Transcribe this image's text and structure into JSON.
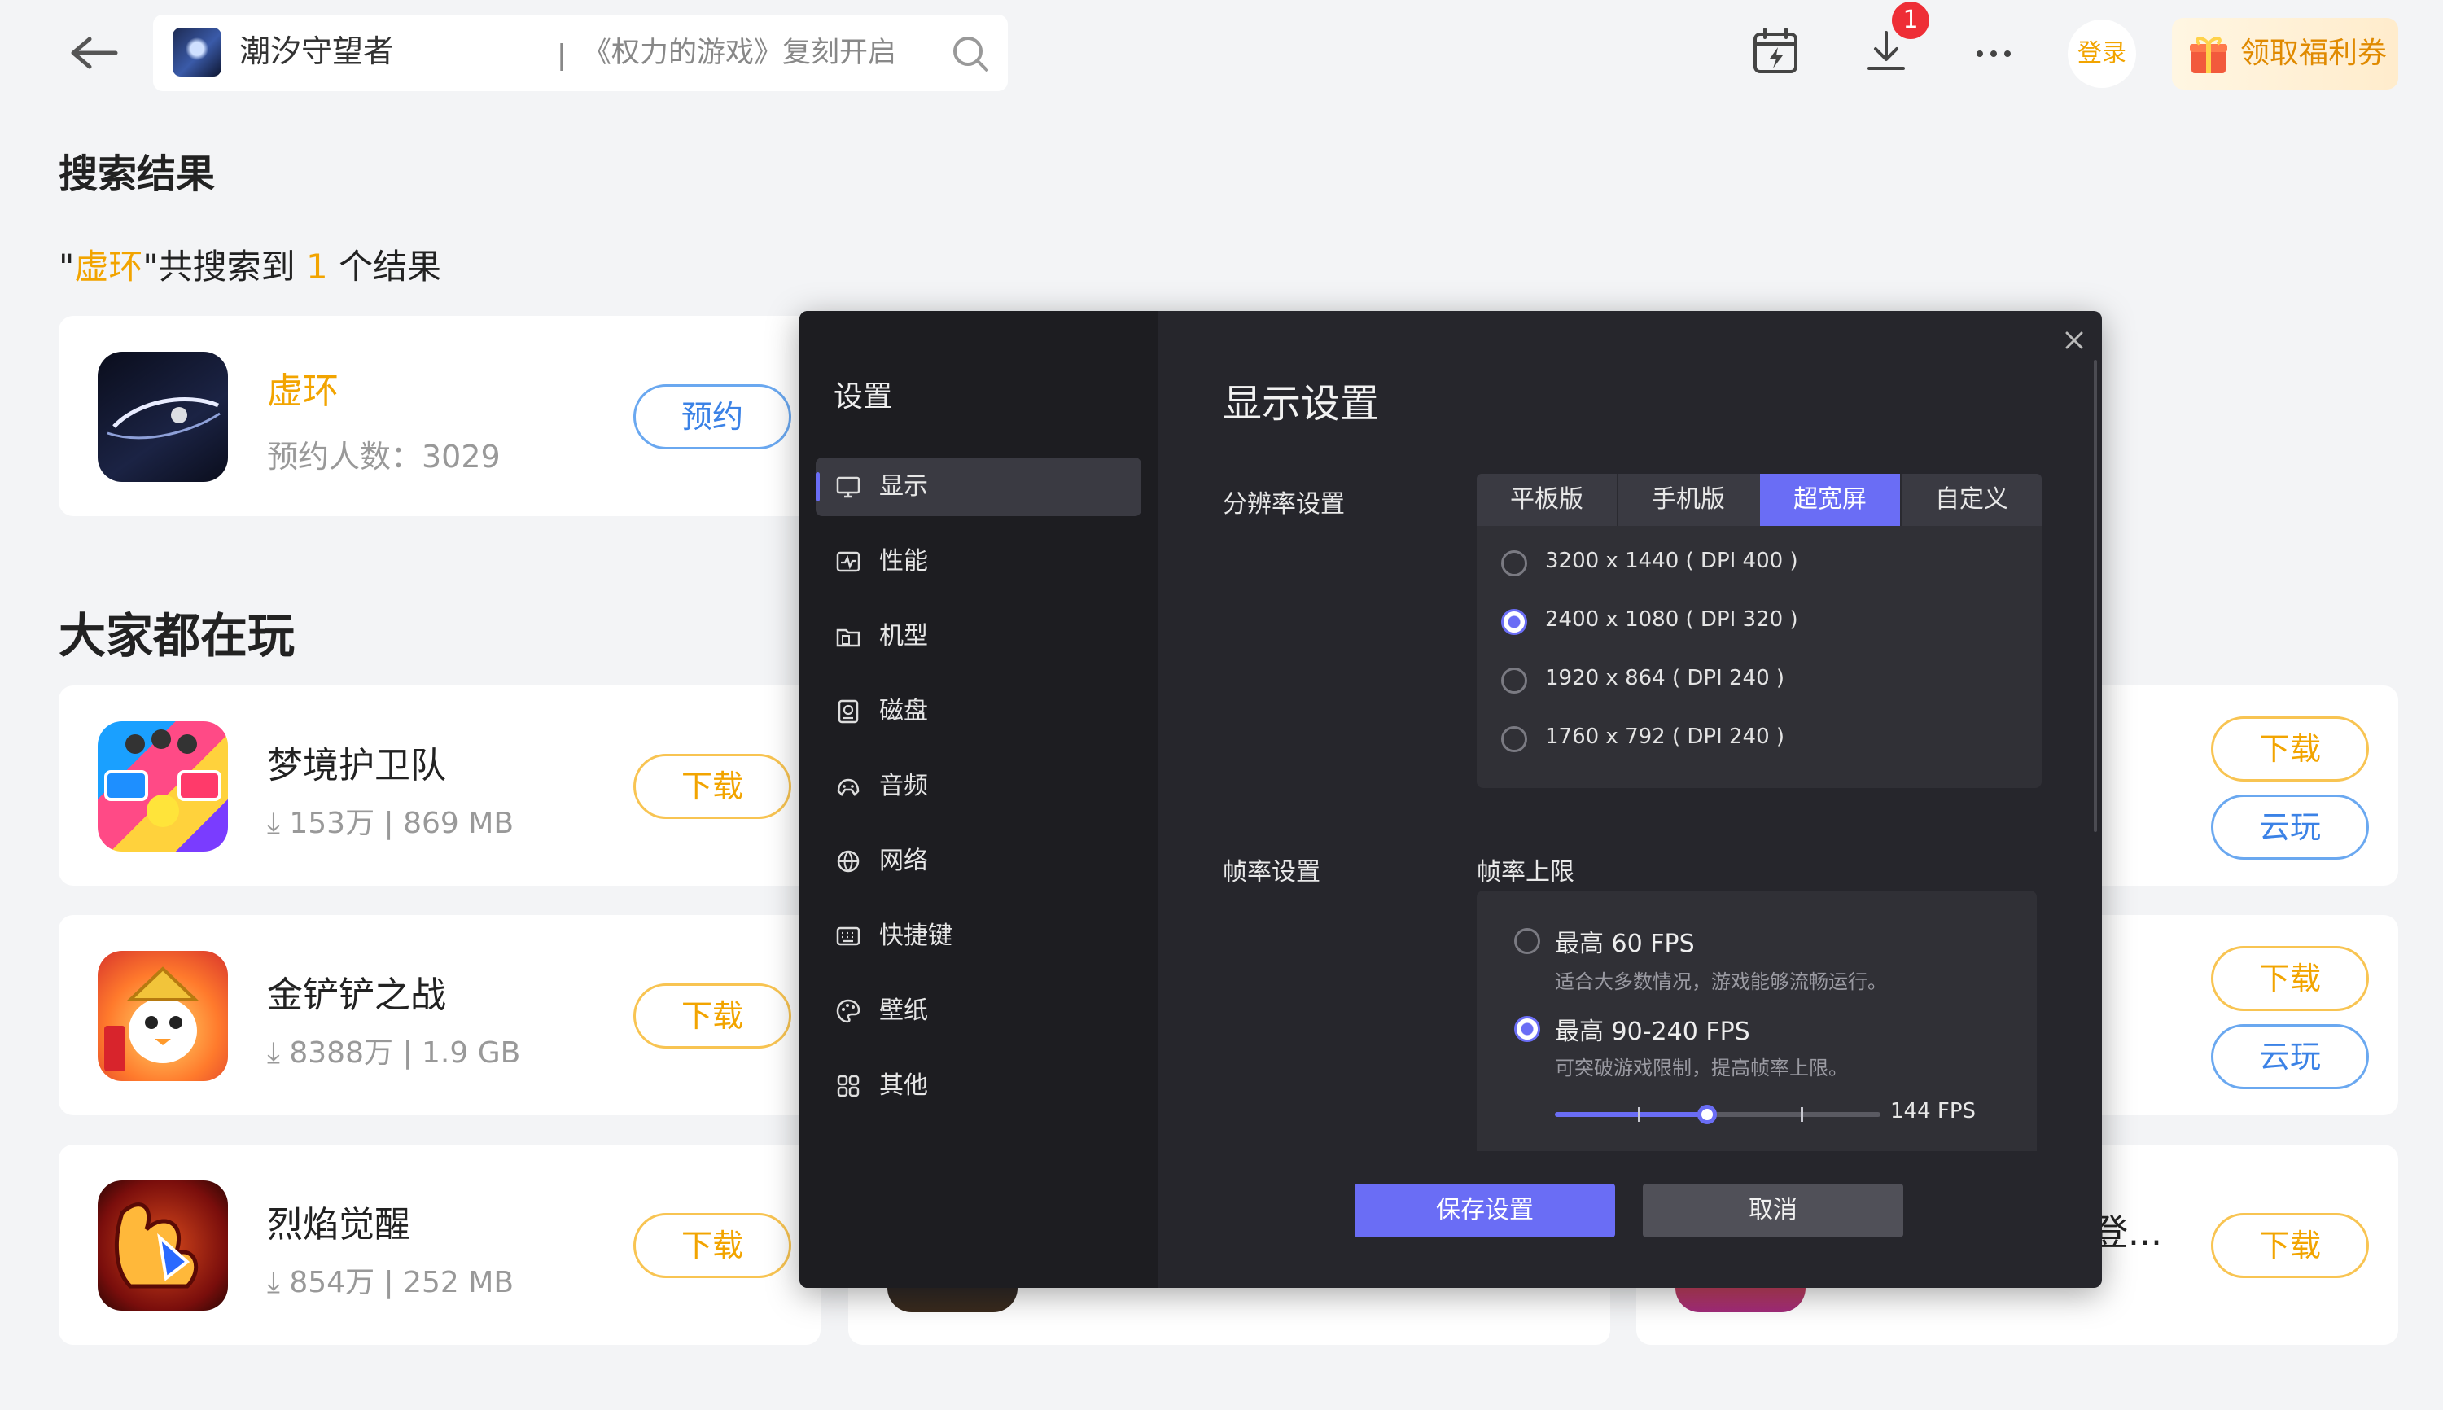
{
  "search": {
    "title": "潮汐守望者",
    "divider": "|",
    "placeholder_text": "《权力的游戏》复刻开启"
  },
  "topbar": {
    "download_badge": "1",
    "login": "登录",
    "coupon": "领取福利券"
  },
  "results": {
    "heading": "搜索结果",
    "summary_prefix": "\"",
    "keyword": "虚环",
    "summary_mid": "\"共搜索到 ",
    "count": "1",
    "summary_suffix": " 个结果",
    "item": {
      "name": "虚环",
      "reserve_count": "预约人数：3029",
      "button": "预约"
    }
  },
  "popular": {
    "heading": "大家都在玩",
    "games": [
      {
        "name": "梦境护卫队",
        "downloads": "153万",
        "size": "869 MB",
        "button": "下载"
      },
      {
        "name": "金铲铲之战",
        "downloads": "8388万",
        "size": "1.9 GB",
        "button": "下载"
      },
      {
        "name": "烈焰觉醒",
        "downloads": "854万",
        "size": "252 MB",
        "button": "下载"
      }
    ],
    "right_column": {
      "download": "下载",
      "cloud": "云玩",
      "truncated_name": "登..."
    }
  },
  "settings": {
    "sidebar_title": "设置",
    "nav": [
      {
        "label": "显示",
        "icon": "monitor-icon",
        "active": true
      },
      {
        "label": "性能",
        "icon": "performance-icon"
      },
      {
        "label": "机型",
        "icon": "device-model-icon"
      },
      {
        "label": "磁盘",
        "icon": "disk-icon"
      },
      {
        "label": "音频",
        "icon": "audio-icon"
      },
      {
        "label": "网络",
        "icon": "network-icon"
      },
      {
        "label": "快捷键",
        "icon": "keyboard-icon"
      },
      {
        "label": "壁纸",
        "icon": "palette-icon"
      },
      {
        "label": "其他",
        "icon": "grid-icon"
      }
    ],
    "title": "显示设置",
    "resolution_label": "分辨率设置",
    "tabs": [
      "平板版",
      "手机版",
      "超宽屏",
      "自定义"
    ],
    "active_tab": "超宽屏",
    "resolutions": [
      {
        "label": "3200 x 1440 ( DPI 400 )",
        "selected": false
      },
      {
        "label": "2400 x 1080 ( DPI 320 )",
        "selected": true
      },
      {
        "label": "1920 x 864 ( DPI 240 )",
        "selected": false
      },
      {
        "label": "1760 x 792 ( DPI 240 )",
        "selected": false
      }
    ],
    "framerate_label": "帧率设置",
    "framerate_limit_label": "帧率上限",
    "fps_options": [
      {
        "name": "最高 60 FPS",
        "desc": "适合大多数情况，游戏能够流畅运行。",
        "selected": false
      },
      {
        "name": "最高 90-240 FPS",
        "desc": "可突破游戏限制，提高帧率上限。",
        "selected": true
      }
    ],
    "fps_slider": {
      "min": 90,
      "max": 240,
      "value": 144,
      "value_label": "144 FPS"
    },
    "save": "保存设置",
    "cancel": "取消"
  },
  "colors": {
    "accent": "#6a6df5",
    "orange": "#f2a400",
    "blue": "#3b82e6",
    "modal_bg": "#26262c"
  }
}
